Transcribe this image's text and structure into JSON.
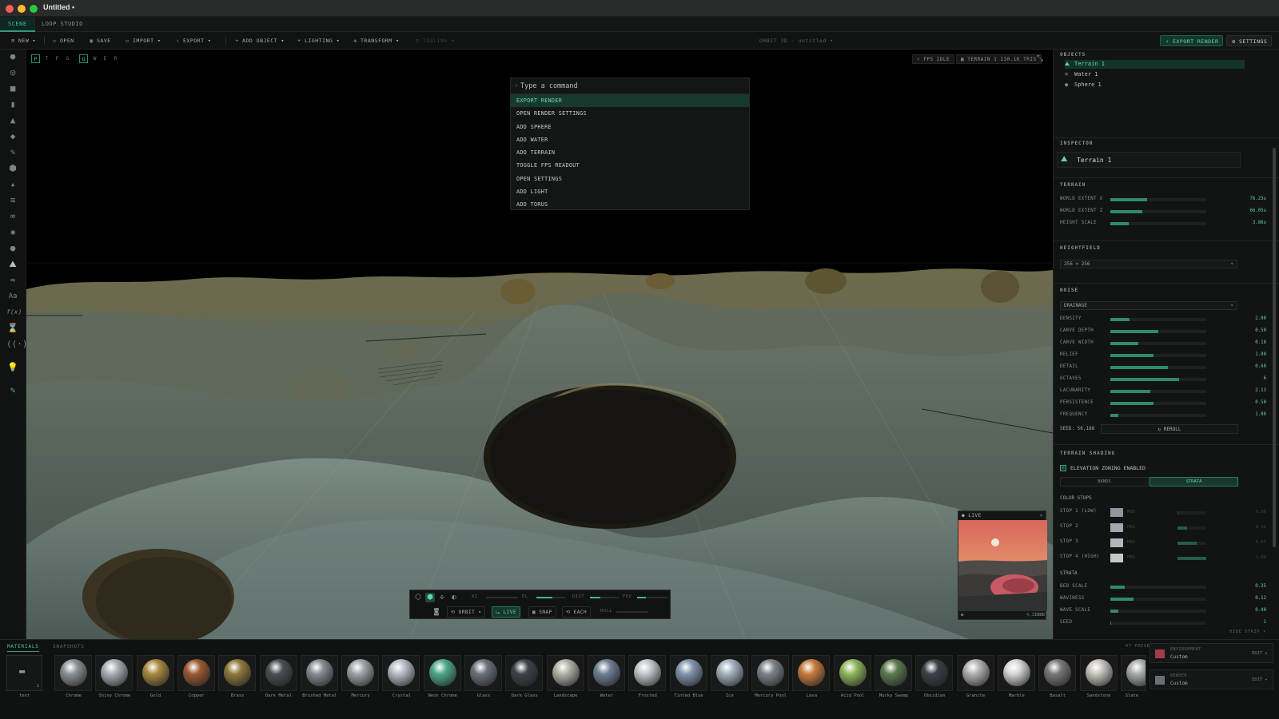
{
  "window": {
    "title": "Untitled •"
  },
  "tabs": [
    "SCENE",
    "LOOP STUDIO"
  ],
  "toolbar": {
    "new": "NEW",
    "open": "OPEN",
    "save": "SAVE",
    "import": "IMPORT",
    "export": "EXPORT",
    "add_object": "ADD OBJECT",
    "lighting": "LIGHTING",
    "transform": "TRANSFORM",
    "tooling": "TOOLING",
    "center_label": "ORBIT 3D · untitled •",
    "export_render": "EXPORT RENDER",
    "settings": "SETTINGS"
  },
  "viewport": {
    "view_toggles": [
      "P",
      "T",
      "F",
      "S",
      "Q",
      "W",
      "E",
      "R"
    ],
    "fps_badge": "FPS IDLE",
    "terrain_badge": "TERRAIN 1 130.1K TRIS"
  },
  "palette": {
    "placeholder": "Type a command",
    "items": [
      "EXPORT RENDER",
      "OPEN RENDER SETTINGS",
      "ADD SPHERE",
      "ADD WATER",
      "ADD TERRAIN",
      "TOGGLE FPS READOUT",
      "OPEN SETTINGS",
      "ADD LIGHT",
      "ADD TORUS"
    ]
  },
  "live_preview": {
    "title": "LIVE",
    "status": "IDLE",
    "value": "4,322MS"
  },
  "camera": {
    "az": "AZ",
    "el": "EL",
    "dist": "DIST",
    "fov": "FOV",
    "roll": "ROLL",
    "az_level": 0.0,
    "el_level": 0.55,
    "dist_level": 0.35,
    "fov_level": 0.3,
    "roll_level": 0.0,
    "orbit": "ORBIT",
    "live": "LIVE",
    "snap": "SNAP",
    "each": "EACH"
  },
  "objects": {
    "title": "OBJECTS",
    "items": [
      {
        "name": "Terrain 1",
        "icon": "mountain-icon",
        "selected": true
      },
      {
        "name": "Water 1",
        "icon": "waves-icon",
        "selected": false
      },
      {
        "name": "Sphere 1",
        "icon": "sphere-icon",
        "selected": false
      }
    ]
  },
  "inspector": {
    "title": "INSPECTOR",
    "object_name": "Terrain 1",
    "terrain": {
      "title": "TERRAIN",
      "rows": [
        {
          "label": "WORLD EXTENT X",
          "value": "76.23u",
          "level": 0.38
        },
        {
          "label": "WORLD EXTENT Z",
          "value": "66.05u",
          "level": 0.33
        },
        {
          "label": "HEIGHT SCALE",
          "value": "3.86u",
          "level": 0.19
        }
      ]
    },
    "heightfield": {
      "title": "HEIGHTFIELD",
      "value": "256 × 256"
    },
    "noise": {
      "title": "NOISE",
      "mode": "DRAINAGE",
      "rows": [
        {
          "label": "DENSITY",
          "value": "2.00",
          "level": 0.2
        },
        {
          "label": "CARVE DEPTH",
          "value": "0.50",
          "level": 0.5
        },
        {
          "label": "CARVE WIDTH",
          "value": "0.18",
          "level": 0.29
        },
        {
          "label": "RELIEF",
          "value": "1.00",
          "level": 0.45
        },
        {
          "label": "DETAIL",
          "value": "0.60",
          "level": 0.6
        },
        {
          "label": "OCTAVES",
          "value": "6",
          "level": 0.72
        },
        {
          "label": "LACUNARITY",
          "value": "2.13",
          "level": 0.42
        },
        {
          "label": "PERSISTENCE",
          "value": "0.50",
          "level": 0.45
        },
        {
          "label": "FREQUENCY",
          "value": "1.00",
          "level": 0.08
        }
      ],
      "seed": "SEED: 56,188",
      "reroll": "REROLL"
    },
    "shading": {
      "title": "TERRAIN SHADING",
      "zoning": "ELEVATION ZONING ENABLED",
      "modes": [
        "BANDS",
        "STRATA"
      ],
      "color_stops_title": "COLOR STOPS",
      "pos_label": "POS",
      "stops": [
        {
          "label": "STOP 1 (LOW)",
          "value": "0.00",
          "color": "#8f97a0"
        },
        {
          "label": "STOP 2",
          "value": "0.32",
          "color": "#a1a8ae"
        },
        {
          "label": "STOP 3",
          "value": "0.67",
          "color": "#b2b7bb"
        },
        {
          "label": "STOP 4 (HIGH)",
          "value": "1.00",
          "color": "#c4c8cb"
        }
      ],
      "stop_levels": [
        0.03,
        0.32,
        0.67,
        1.0
      ],
      "strata_title": "STRATA",
      "strata_rows": [
        {
          "label": "BED SCALE",
          "value": "0.35",
          "level": 0.15
        },
        {
          "label": "WAVINESS",
          "value": "0.12",
          "level": 0.24
        },
        {
          "label": "WAVE SCALE",
          "value": "0.40",
          "level": 0.08
        },
        {
          "label": "SEED",
          "value": "1",
          "level": 0.01
        }
      ]
    }
  },
  "strip": {
    "tabs": [
      "MATERIALS",
      "SNAPSHOTS"
    ],
    "presets": "67 PRESETS",
    "hide": "HIDE STRIP",
    "folder": {
      "name": "test",
      "count": "1"
    },
    "materials": [
      {
        "name": "Chrome",
        "color": "#8c9196"
      },
      {
        "name": "Shiny Chrome",
        "color": "#a9aeb4"
      },
      {
        "name": "Gold",
        "color": "#a8893f"
      },
      {
        "name": "Copper",
        "color": "#9a5b34"
      },
      {
        "name": "Brass",
        "color": "#8d7a3c"
      },
      {
        "name": "Dark Metal",
        "color": "#4b4e53"
      },
      {
        "name": "Brushed Metal",
        "color": "#878b8f"
      },
      {
        "name": "Mercury",
        "color": "#9ea2a8"
      },
      {
        "name": "Crystal",
        "color": "#b7bdc4"
      },
      {
        "name": "Neon Chrome",
        "color": "#4fa78a"
      },
      {
        "name": "Glass",
        "color": "#6c727a"
      },
      {
        "name": "Dark Glass",
        "color": "#3f4348"
      },
      {
        "name": "Landscape",
        "color": "#b3b0a6"
      },
      {
        "name": "Water",
        "color": "#6f8193"
      },
      {
        "name": "Frosted",
        "color": "#c3c7cc"
      },
      {
        "name": "Tinted Blue",
        "color": "#8296ad"
      },
      {
        "name": "Ice",
        "color": "#a4b1bd"
      },
      {
        "name": "Mercury Pool",
        "color": "#7e8388"
      },
      {
        "name": "Lava",
        "color": "#c87b40"
      },
      {
        "name": "Acid Pool",
        "color": "#8fb65d"
      },
      {
        "name": "Murky Swamp",
        "color": "#5c7a4f"
      },
      {
        "name": "Obsidian",
        "color": "#3d3f47"
      },
      {
        "name": "Granite",
        "color": "#b1b1b0"
      },
      {
        "name": "Marble",
        "color": "#d6d6d4"
      },
      {
        "name": "Basalt",
        "color": "#7a7876"
      },
      {
        "name": "Sandstone",
        "color": "#c9c5bd"
      },
      {
        "name": "Slate",
        "color": "#a9aaab"
      }
    ],
    "environment": {
      "key": "ENVIRONMENT",
      "value": "Custom",
      "edit": "EDIT ▸",
      "color": "#a33a4a"
    },
    "render": {
      "key": "RENDER",
      "value": "Custom",
      "edit": "EDIT ▸",
      "color": "#6b6f72"
    }
  },
  "colors": {
    "accent": "#2e9c77",
    "accent_text": "#5fd2a9",
    "background": "#0b0c0c"
  }
}
